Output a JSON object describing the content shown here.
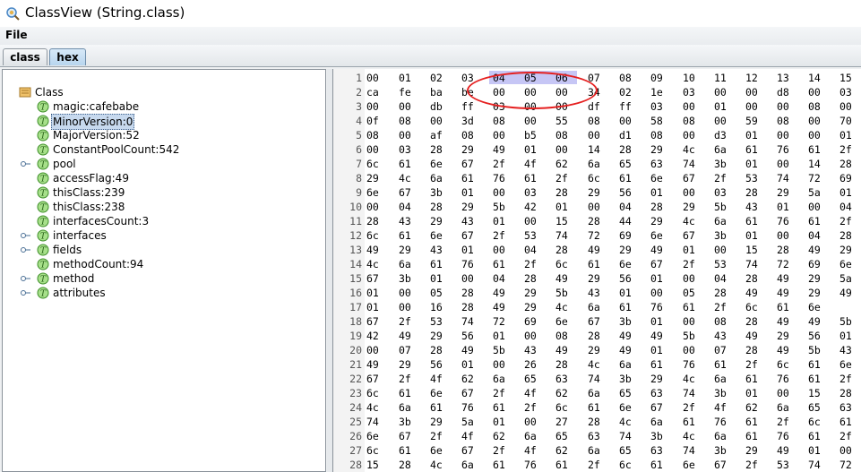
{
  "window": {
    "title": "ClassView (String.class)",
    "icon": "search-class-icon"
  },
  "menu": {
    "file_label": "File"
  },
  "tabs": [
    {
      "label": "class"
    },
    {
      "label": "hex",
      "active": true
    }
  ],
  "tree": {
    "root": "Class",
    "items": [
      {
        "label": "magic:cafebabe",
        "expandable": false
      },
      {
        "label": "MinorVersion:0",
        "expandable": false,
        "selected": true
      },
      {
        "label": "MajorVersion:52",
        "expandable": false
      },
      {
        "label": "ConstantPoolCount:542",
        "expandable": false
      },
      {
        "label": "pool",
        "expandable": true
      },
      {
        "label": "accessFlag:49",
        "expandable": false
      },
      {
        "label": "thisClass:239",
        "expandable": false
      },
      {
        "label": "thisClass:238",
        "expandable": false
      },
      {
        "label": "interfacesCount:3",
        "expandable": false
      },
      {
        "label": "interfaces",
        "expandable": true
      },
      {
        "label": "fields",
        "expandable": true
      },
      {
        "label": "methodCount:94",
        "expandable": false
      },
      {
        "label": "method",
        "expandable": true
      },
      {
        "label": "attributes",
        "expandable": true
      }
    ]
  },
  "hex": {
    "rows": [
      [
        "1",
        [
          "00",
          "01",
          "02",
          "03",
          "04",
          "05",
          "06",
          "07",
          "08",
          "09",
          "10",
          "11",
          "12",
          "13",
          "14",
          "15"
        ]
      ],
      [
        "2",
        [
          "ca",
          "fe",
          "ba",
          "be",
          "00",
          "00",
          "00",
          "34",
          "02",
          "1e",
          "03",
          "00",
          "00",
          "d8",
          "00",
          "03"
        ]
      ],
      [
        "3",
        [
          "00",
          "00",
          "db",
          "ff",
          "03",
          "00",
          "00",
          "df",
          "ff",
          "03",
          "00",
          "01",
          "00",
          "00",
          "08",
          "00"
        ]
      ],
      [
        "4",
        [
          "0f",
          "08",
          "00",
          "3d",
          "08",
          "00",
          "55",
          "08",
          "00",
          "58",
          "08",
          "00",
          "59",
          "08",
          "00",
          "70"
        ]
      ],
      [
        "5",
        [
          "08",
          "00",
          "af",
          "08",
          "00",
          "b5",
          "08",
          "00",
          "d1",
          "08",
          "00",
          "d3",
          "01",
          "00",
          "00",
          "01"
        ]
      ],
      [
        "6",
        [
          "00",
          "03",
          "28",
          "29",
          "49",
          "01",
          "00",
          "14",
          "28",
          "29",
          "4c",
          "6a",
          "61",
          "76",
          "61",
          "2f"
        ]
      ],
      [
        "7",
        [
          "6c",
          "61",
          "6e",
          "67",
          "2f",
          "4f",
          "62",
          "6a",
          "65",
          "63",
          "74",
          "3b",
          "01",
          "00",
          "14",
          "28"
        ]
      ],
      [
        "8",
        [
          "29",
          "4c",
          "6a",
          "61",
          "76",
          "61",
          "2f",
          "6c",
          "61",
          "6e",
          "67",
          "2f",
          "53",
          "74",
          "72",
          "69"
        ]
      ],
      [
        "9",
        [
          "6e",
          "67",
          "3b",
          "01",
          "00",
          "03",
          "28",
          "29",
          "56",
          "01",
          "00",
          "03",
          "28",
          "29",
          "5a",
          "01"
        ]
      ],
      [
        "10",
        [
          "00",
          "04",
          "28",
          "29",
          "5b",
          "42",
          "01",
          "00",
          "04",
          "28",
          "29",
          "5b",
          "43",
          "01",
          "00",
          "04"
        ]
      ],
      [
        "11",
        [
          "28",
          "43",
          "29",
          "43",
          "01",
          "00",
          "15",
          "28",
          "44",
          "29",
          "4c",
          "6a",
          "61",
          "76",
          "61",
          "2f"
        ]
      ],
      [
        "12",
        [
          "6c",
          "61",
          "6e",
          "67",
          "2f",
          "53",
          "74",
          "72",
          "69",
          "6e",
          "67",
          "3b",
          "01",
          "00",
          "04",
          "28"
        ]
      ],
      [
        "13",
        [
          "49",
          "29",
          "43",
          "01",
          "00",
          "04",
          "28",
          "49",
          "29",
          "49",
          "01",
          "00",
          "15",
          "28",
          "49",
          "29"
        ]
      ],
      [
        "14",
        [
          "4c",
          "6a",
          "61",
          "76",
          "61",
          "2f",
          "6c",
          "61",
          "6e",
          "67",
          "2f",
          "53",
          "74",
          "72",
          "69",
          "6e"
        ]
      ],
      [
        "15",
        [
          "67",
          "3b",
          "01",
          "00",
          "04",
          "28",
          "49",
          "29",
          "56",
          "01",
          "00",
          "04",
          "28",
          "49",
          "29",
          "5a"
        ]
      ],
      [
        "16",
        [
          "01",
          "00",
          "05",
          "28",
          "49",
          "29",
          "5b",
          "43",
          "01",
          "00",
          "05",
          "28",
          "49",
          "49",
          "29",
          "49"
        ]
      ],
      [
        "17",
        [
          "01",
          "00",
          "16",
          "28",
          "49",
          "29",
          "4c",
          "6a",
          "61",
          "76",
          "61",
          "2f",
          "6c",
          "61",
          "6e"
        ]
      ],
      [
        "18",
        [
          "67",
          "2f",
          "53",
          "74",
          "72",
          "69",
          "6e",
          "67",
          "3b",
          "01",
          "00",
          "08",
          "28",
          "49",
          "49",
          "5b"
        ]
      ],
      [
        "19",
        [
          "42",
          "49",
          "29",
          "56",
          "01",
          "00",
          "08",
          "28",
          "49",
          "49",
          "5b",
          "43",
          "49",
          "29",
          "56",
          "01"
        ]
      ],
      [
        "20",
        [
          "00",
          "07",
          "28",
          "49",
          "5b",
          "43",
          "49",
          "29",
          "49",
          "01",
          "00",
          "07",
          "28",
          "49",
          "5b",
          "43"
        ]
      ],
      [
        "21",
        [
          "49",
          "29",
          "56",
          "01",
          "00",
          "26",
          "28",
          "4c",
          "6a",
          "61",
          "76",
          "61",
          "2f",
          "6c",
          "61",
          "6e"
        ]
      ],
      [
        "22",
        [
          "67",
          "2f",
          "4f",
          "62",
          "6a",
          "65",
          "63",
          "74",
          "3b",
          "29",
          "4c",
          "6a",
          "61",
          "76",
          "61",
          "2f"
        ]
      ],
      [
        "23",
        [
          "6c",
          "61",
          "6e",
          "67",
          "2f",
          "4f",
          "62",
          "6a",
          "65",
          "63",
          "74",
          "3b",
          "01",
          "00",
          "15",
          "28"
        ]
      ],
      [
        "24",
        [
          "4c",
          "6a",
          "61",
          "76",
          "61",
          "2f",
          "6c",
          "61",
          "6e",
          "67",
          "2f",
          "4f",
          "62",
          "6a",
          "65",
          "63"
        ]
      ],
      [
        "25",
        [
          "74",
          "3b",
          "29",
          "5a",
          "01",
          "00",
          "27",
          "28",
          "4c",
          "6a",
          "61",
          "76",
          "61",
          "2f",
          "6c",
          "61"
        ]
      ],
      [
        "26",
        [
          "6e",
          "67",
          "2f",
          "4f",
          "62",
          "6a",
          "65",
          "63",
          "74",
          "3b",
          "4c",
          "6a",
          "61",
          "76",
          "61",
          "2f"
        ]
      ],
      [
        "27",
        [
          "6c",
          "61",
          "6e",
          "67",
          "2f",
          "4f",
          "62",
          "6a",
          "65",
          "63",
          "74",
          "3b",
          "29",
          "49",
          "01",
          "00"
        ]
      ],
      [
        "28",
        [
          "15",
          "28",
          "4c",
          "6a",
          "61",
          "76",
          "61",
          "2f",
          "6c",
          "61",
          "6e",
          "67",
          "2f",
          "53",
          "74",
          "72"
        ]
      ]
    ]
  }
}
